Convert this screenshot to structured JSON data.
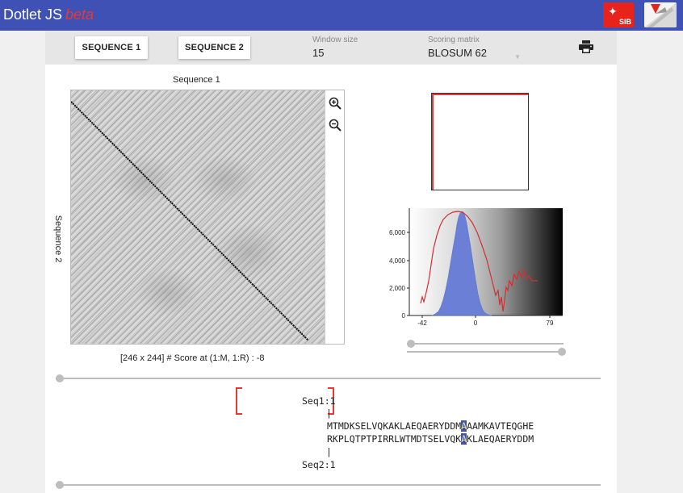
{
  "app": {
    "title": "Dotlet JS",
    "beta": "beta",
    "logos": {
      "sib": "SIB",
      "vital_it": ""
    }
  },
  "toolbar": {
    "sequence1_label": "SEQUENCE 1",
    "sequence2_label": "SEQUENCE 2",
    "window_size": {
      "label": "Window size",
      "value": "15"
    },
    "scoring_matrix": {
      "label": "Scoring matrix",
      "value": "BLOSUM 62"
    },
    "print_icon": "printer-icon"
  },
  "dotplot": {
    "x_title": "Sequence 1",
    "y_title": "Sequence 2",
    "zoom_in_icon": "zoom-in-icon",
    "zoom_out_icon": "zoom-out-icon",
    "score_info": "[246 x 244] # Score at (1:M, 1:R) : -8"
  },
  "histogram": {
    "y_ticks": [
      "6,000",
      "4,000",
      "2,000",
      "0"
    ],
    "x_ticks": [
      "-42",
      "0",
      "79"
    ],
    "colors": {
      "bars": "#6b7fd6",
      "line": "#d32f2f"
    }
  },
  "alignment": {
    "seq1_label": "Seq1:1",
    "seq2_label": "Seq2:1",
    "seq1_pre": "MTMDKSELVQKAKLAEQAERYDDM",
    "seq1_hl": "A",
    "seq1_post": "AAMKAVTEQGHE",
    "seq2_pre": "RKPLQTPTPIRRLWTMDTSELVQK",
    "seq2_hl": "A",
    "seq2_post": "KLAEQAERYDDM",
    "tick": "|"
  },
  "colors": {
    "appbar": "#3f51b5",
    "beta": "#e53935",
    "highlight": "#3f51b5"
  }
}
